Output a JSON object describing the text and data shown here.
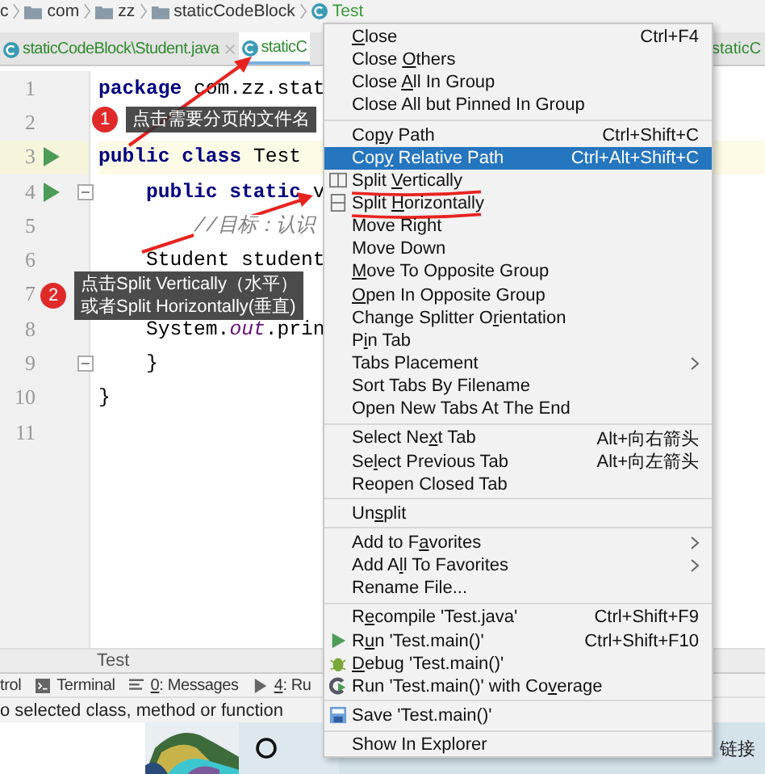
{
  "breadcrumbs": [
    {
      "label": "c",
      "kind": "text"
    },
    {
      "label": "com",
      "kind": "folder"
    },
    {
      "label": "zz",
      "kind": "folder"
    },
    {
      "label": "staticCodeBlock",
      "kind": "folder"
    },
    {
      "label": "Test",
      "kind": "class"
    }
  ],
  "tabs": [
    {
      "label": "staticCodeBlock\\Student.java",
      "selected": false,
      "closable": true
    },
    {
      "label": "staticC",
      "selected": true,
      "closable": false
    }
  ],
  "right_tab": {
    "label": "staticC"
  },
  "editor": {
    "lines": [
      {
        "number": "1",
        "current": false,
        "run": false,
        "fold": false,
        "code": [
          {
            "kind": "keyword",
            "text": "package"
          },
          {
            "kind": "plain",
            "text": " com.zz.stat"
          }
        ]
      },
      {
        "number": "2",
        "current": false,
        "run": false,
        "fold": false
      },
      {
        "number": "3",
        "current": true,
        "run": true,
        "fold": false,
        "code": [
          {
            "kind": "keyword",
            "text": "public class"
          },
          {
            "kind": "plain",
            "text": " Test"
          }
        ]
      },
      {
        "number": "4",
        "current": false,
        "run": true,
        "fold": true,
        "code": [
          {
            "kind": "keyword",
            "text": "    public static"
          },
          {
            "kind": "plain",
            "text": " v"
          }
        ]
      },
      {
        "number": "5",
        "current": false,
        "run": false,
        "fold": false,
        "code": [
          {
            "kind": "comment",
            "text": "        //目标：认识"
          }
        ]
      },
      {
        "number": "6",
        "current": false,
        "run": false,
        "fold": false,
        "code": [
          {
            "kind": "plain",
            "text": "    Student student"
          }
        ]
      },
      {
        "number": "7",
        "current": false,
        "run": false,
        "fold": false
      },
      {
        "number": "8",
        "current": false,
        "run": false,
        "fold": false,
        "code": [
          {
            "kind": "plain",
            "text": "    System."
          },
          {
            "kind": "static",
            "text": "out"
          },
          {
            "kind": "plain",
            "text": ".prin"
          }
        ]
      },
      {
        "number": "9",
        "current": false,
        "run": false,
        "fold": true,
        "code": [
          {
            "kind": "plain",
            "text": "    }"
          }
        ]
      },
      {
        "number": "10",
        "current": false,
        "run": false,
        "fold": false,
        "code": [
          {
            "kind": "plain",
            "text": "}"
          }
        ]
      },
      {
        "number": "11",
        "current": false,
        "run": false,
        "fold": false
      }
    ],
    "footer": "Test"
  },
  "callouts": [
    {
      "badge": "1",
      "lines": [
        "点击需要分页的文件名"
      ]
    },
    {
      "badge": "2",
      "lines": [
        "点击Split Vertically（水平）",
        "或者Split Horizontally(垂直)"
      ]
    }
  ],
  "menu": {
    "items": [
      {
        "kind": "item",
        "selected": false,
        "key": "C",
        "post": "lose",
        "shortcut": "Ctrl+F4"
      },
      {
        "kind": "item",
        "selected": false,
        "pre": "Close ",
        "key": "O",
        "post": "thers"
      },
      {
        "kind": "item",
        "selected": false,
        "pre": "Close ",
        "key": "A",
        "post": "ll In Group"
      },
      {
        "kind": "item",
        "selected": false,
        "label": "Close All but Pinned In Group"
      },
      {
        "kind": "separator"
      },
      {
        "kind": "item",
        "selected": false,
        "pre": "Co",
        "key": "p",
        "post": "y Path",
        "shortcut": "Ctrl+Shift+C"
      },
      {
        "kind": "item",
        "selected": true,
        "pre": "Cop",
        "key": "y",
        "post": " Relative Path",
        "shortcut": "Ctrl+Alt+Shift+C"
      },
      {
        "kind": "splitv",
        "selected": false,
        "marked": true,
        "pre": "Split ",
        "key": "V",
        "post": "ertically"
      },
      {
        "kind": "splith",
        "selected": false,
        "marked": true,
        "pre": "Split ",
        "key": "H",
        "post": "orizontally"
      },
      {
        "kind": "item",
        "selected": false,
        "label": "Move Right"
      },
      {
        "kind": "item",
        "selected": false,
        "label": "Move Down"
      },
      {
        "kind": "item",
        "selected": false,
        "key": "M",
        "post": "ove To Opposite Group"
      },
      {
        "kind": "item",
        "selected": false,
        "key": "O",
        "post": "pen In Opposite Group"
      },
      {
        "kind": "item",
        "selected": false,
        "pre": "Change Splitter O",
        "key": "r",
        "post": "ientation"
      },
      {
        "kind": "item",
        "selected": false,
        "pre": "P",
        "key": "i",
        "post": "n Tab"
      },
      {
        "kind": "item",
        "selected": false,
        "label": "Tabs Placement",
        "submenu": true
      },
      {
        "kind": "item",
        "selected": false,
        "label": "Sort Tabs By Filename"
      },
      {
        "kind": "item",
        "selected": false,
        "label": "Open New Tabs At The End"
      },
      {
        "kind": "separator"
      },
      {
        "kind": "item",
        "selected": false,
        "pre": "Select Ne",
        "key": "x",
        "post": "t Tab",
        "shortcut": "Alt+向右箭头"
      },
      {
        "kind": "item",
        "selected": false,
        "pre": "Se",
        "key": "l",
        "post": "ect Previous Tab",
        "shortcut": "Alt+向左箭头"
      },
      {
        "kind": "item",
        "selected": false,
        "label": "Reopen Closed Tab"
      },
      {
        "kind": "separator"
      },
      {
        "kind": "item",
        "selected": false,
        "pre": "Un",
        "key": "s",
        "post": "plit"
      },
      {
        "kind": "separator"
      },
      {
        "kind": "item",
        "selected": false,
        "pre": "Add to F",
        "key": "a",
        "post": "vorites",
        "submenu": true
      },
      {
        "kind": "item",
        "selected": false,
        "pre": "Add A",
        "key": "l",
        "post": "l To Favorites",
        "submenu": true
      },
      {
        "kind": "item",
        "selected": false,
        "label": "Rename File..."
      },
      {
        "kind": "separator"
      },
      {
        "kind": "item",
        "selected": false,
        "pre": "R",
        "key": "e",
        "post": "compile 'Test.java'",
        "shortcut": "Ctrl+Shift+F9"
      },
      {
        "kind": "run",
        "selected": false,
        "pre": "R",
        "key": "u",
        "post": "n 'Test.main()'",
        "shortcut": "Ctrl+Shift+F10"
      },
      {
        "kind": "debug",
        "selected": false,
        "key": "D",
        "post": "ebug 'Test.main()'"
      },
      {
        "kind": "coverage",
        "selected": false,
        "pre": "Run 'Test.main()' with Co",
        "key": "v",
        "post": "erage"
      },
      {
        "kind": "separator"
      },
      {
        "kind": "save",
        "selected": false,
        "label": "Save 'Test.main()'"
      },
      {
        "kind": "separator"
      },
      {
        "kind": "item",
        "selected": false,
        "label": "Show In Explorer"
      }
    ]
  },
  "tool_windows": [
    {
      "label": "trol",
      "kind": "text"
    },
    {
      "label": "Terminal",
      "kind": "terminal"
    },
    {
      "key": "0",
      "post": ": Messages",
      "kind": "messages"
    },
    {
      "key": "4",
      "post": ": Ru",
      "kind": "run"
    }
  ],
  "status_bar": "o selected class, method or function",
  "taskbar": {
    "tray_text": "链接"
  }
}
